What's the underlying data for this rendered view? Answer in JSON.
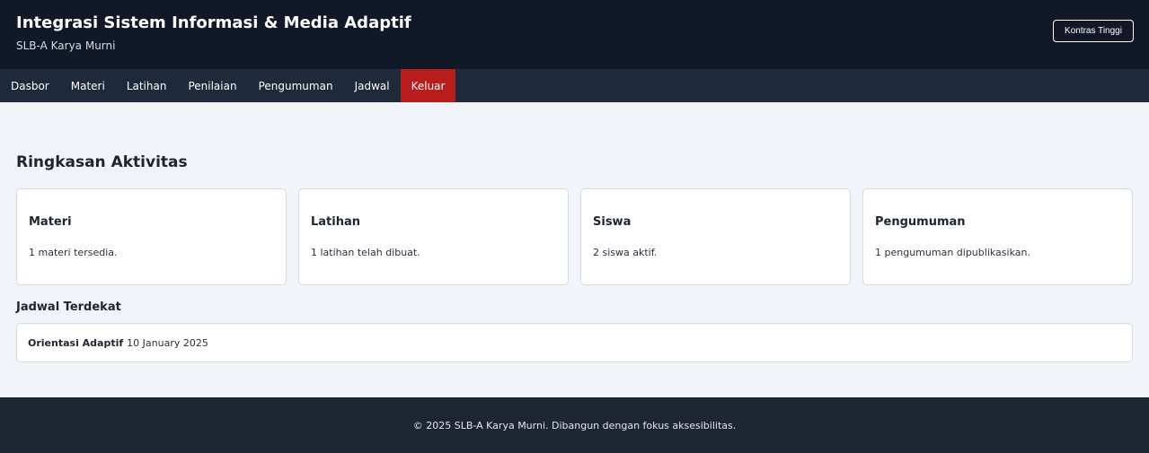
{
  "header": {
    "title": "Integrasi Sistem Informasi & Media Adaptif",
    "subtitle": "SLB-A Karya Murni",
    "contrast_button": "Kontras Tinggi"
  },
  "nav": {
    "items": [
      "Dasbor",
      "Materi",
      "Latihan",
      "Penilaian",
      "Pengumuman",
      "Jadwal",
      "Keluar"
    ]
  },
  "main": {
    "section_title": "Ringkasan Aktivitas",
    "cards": [
      {
        "title": "Materi",
        "text": "1 materi tersedia."
      },
      {
        "title": "Latihan",
        "text": "1 latihan telah dibuat."
      },
      {
        "title": "Siswa",
        "text": "2 siswa aktif."
      },
      {
        "title": "Pengumuman",
        "text": "1 pengumuman dipublikasikan."
      }
    ],
    "schedule_heading": "Jadwal Terdekat",
    "schedule": {
      "name": "Orientasi Adaptif",
      "date": "10 January 2025"
    }
  },
  "footer": {
    "text": "© 2025 SLB-A Karya Murni. Dibangun dengan fokus aksesibilitas."
  },
  "colors": {
    "header_bg": "#111827",
    "nav_bg": "#1e293b",
    "logout_bg": "#b91c1c",
    "page_bg": "#f1f4f8",
    "footer_bg": "#1e2533"
  }
}
